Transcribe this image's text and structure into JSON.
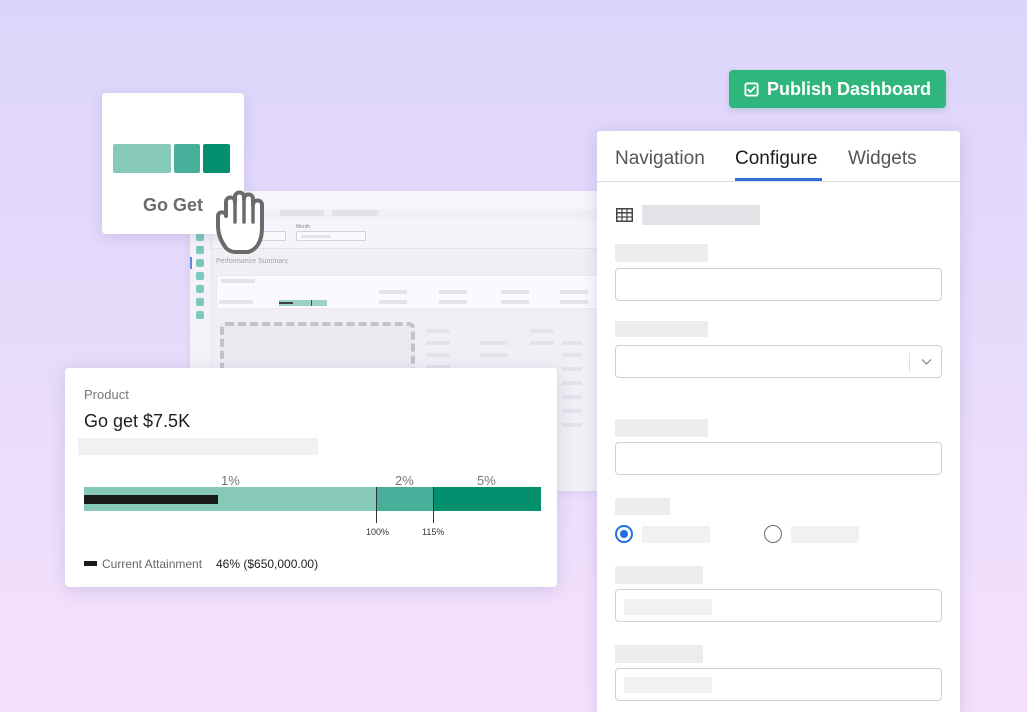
{
  "publish_button": {
    "label": "Publish Dashboard"
  },
  "drag_card": {
    "title": "Go Get",
    "swatches": [
      "#86c9b9",
      "#47b09a",
      "#04906f"
    ]
  },
  "background_dashboard": {
    "filter_label": "Month",
    "section_title": "Performance Summary"
  },
  "config_panel": {
    "tabs": [
      {
        "label": "Navigation",
        "active": false
      },
      {
        "label": "Configure",
        "active": true
      },
      {
        "label": "Widgets",
        "active": false
      }
    ],
    "radio_options": [
      {
        "selected": true
      },
      {
        "selected": false
      }
    ]
  },
  "product_card": {
    "label": "Product",
    "value": "Go get $7.5K",
    "ranges": [
      {
        "label": "1%",
        "color": "#86c9b9"
      },
      {
        "label": "2%",
        "color": "#47b09a"
      },
      {
        "label": "5%",
        "color": "#04906f"
      }
    ],
    "markers": [
      {
        "label": "100%"
      },
      {
        "label": "115%"
      }
    ],
    "attainment_fraction": 0.46,
    "legend": {
      "label": "Current Attainment",
      "value": "46% ($650,000.00)"
    }
  },
  "colors": {
    "accent_green": "#2eb67d",
    "tab_accent": "#2f6fd8",
    "radio_accent": "#1f6fe0"
  }
}
